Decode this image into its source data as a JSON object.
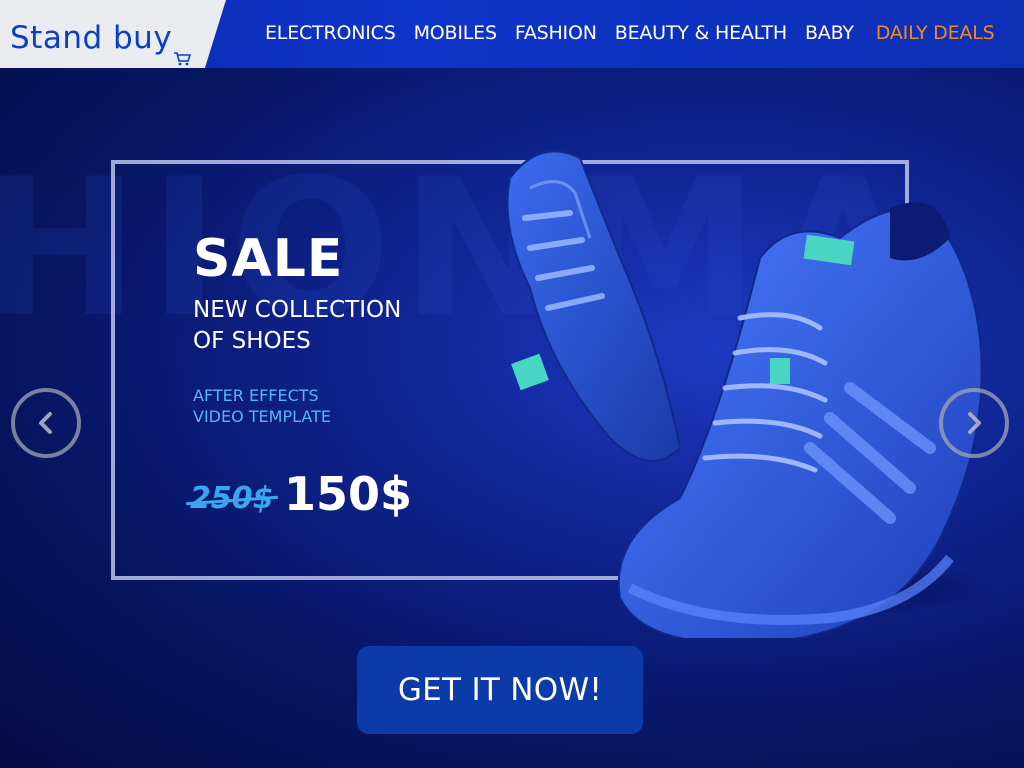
{
  "brand": {
    "name": "Stand buy"
  },
  "nav": {
    "items": [
      "ELECTRONICS",
      "MOBILES",
      "FASHION",
      "BEAUTY & HEALTH",
      "BABY"
    ],
    "deals": "DAILY DEALS"
  },
  "hero": {
    "background_word": "HIONMA",
    "headline": "SALE",
    "subline_1": "NEW COLLECTION",
    "subline_2": "OF SHOES",
    "tagline_1": "AFTER EFFECTS",
    "tagline_2": "VIDEO TEMPLATE",
    "old_price": "250$",
    "new_price": "150$",
    "cta": "GET IT NOW!",
    "prev_icon": "chevron-left-icon",
    "next_icon": "chevron-right-icon"
  },
  "colors": {
    "header": "#0f34c8",
    "deals": "#f08a24",
    "accent_price": "#3aa6ef",
    "cta": "#0c3aa8"
  }
}
